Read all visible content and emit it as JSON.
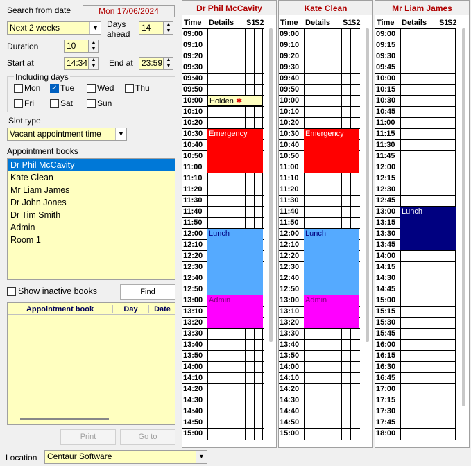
{
  "search": {
    "from_date_label": "Search from date",
    "from_date_value": "Mon 17/06/2024",
    "period_value": "Next 2 weeks",
    "days_ahead_label": "Days ahead",
    "days_ahead_value": "14",
    "duration_label": "Duration",
    "duration_value": "10",
    "start_label": "Start at",
    "start_value": "14:34",
    "end_label": "End at",
    "end_value": "23:59",
    "including_days_label": "Including days",
    "days": [
      {
        "label": "Mon",
        "checked": false
      },
      {
        "label": "Tue",
        "checked": true
      },
      {
        "label": "Wed",
        "checked": false
      },
      {
        "label": "Thu",
        "checked": false
      },
      {
        "label": "Fri",
        "checked": false
      },
      {
        "label": "Sat",
        "checked": false
      },
      {
        "label": "Sun",
        "checked": false
      }
    ],
    "slot_type_label": "Slot type",
    "slot_type_value": "Vacant appointment time",
    "books_label": "Appointment books",
    "books": [
      "Dr Phil McCavity",
      "Kate Clean",
      "Mr Liam James",
      "Dr John Jones",
      "Dr Tim Smith",
      "Admin",
      "Room 1"
    ],
    "show_inactive_label": "Show inactive books",
    "find_label": "Find",
    "results_headers": [
      "Appointment book",
      "Day",
      "Date"
    ],
    "print_label": "Print",
    "goto_label": "Go to",
    "location_label": "Location",
    "location_value": "Centaur Software"
  },
  "diary": {
    "headers": [
      "Time",
      "Details",
      "S1",
      "S2"
    ],
    "columns": [
      {
        "name": "Dr Phil McCavity",
        "times": [
          "09:00",
          "09:10",
          "09:20",
          "09:30",
          "09:40",
          "09:50",
          "10:00",
          "10:10",
          "10:20",
          "10:30",
          "10:40",
          "10:50",
          "11:00",
          "11:10",
          "11:20",
          "11:30",
          "11:40",
          "11:50",
          "12:00",
          "12:10",
          "12:20",
          "12:30",
          "12:40",
          "12:50",
          "13:00",
          "13:10",
          "13:20",
          "13:30",
          "13:40",
          "13:50",
          "14:00",
          "14:10",
          "14:20",
          "14:30",
          "14:40",
          "14:50",
          "15:00"
        ],
        "appointments": [
          {
            "label": "Holden",
            "start": 6,
            "length": 1,
            "color": "#ffffc0",
            "text": "#000000",
            "icon": true
          },
          {
            "label": "Emergency",
            "start": 9,
            "length": 4,
            "color": "#ff0000",
            "text": "#ffffff"
          },
          {
            "label": "Lunch",
            "start": 18,
            "length": 6,
            "color": "#55aaff",
            "text": "#000080"
          },
          {
            "label": "Admin",
            "start": 24,
            "length": 3,
            "color": "#ff00ff",
            "text": "#800080"
          }
        ]
      },
      {
        "name": "Kate Clean",
        "times": [
          "09:00",
          "09:10",
          "09:20",
          "09:30",
          "09:40",
          "09:50",
          "10:00",
          "10:10",
          "10:20",
          "10:30",
          "10:40",
          "10:50",
          "11:00",
          "11:10",
          "11:20",
          "11:30",
          "11:40",
          "11:50",
          "12:00",
          "12:10",
          "12:20",
          "12:30",
          "12:40",
          "12:50",
          "13:00",
          "13:10",
          "13:20",
          "13:30",
          "13:40",
          "13:50",
          "14:00",
          "14:10",
          "14:20",
          "14:30",
          "14:40",
          "14:50",
          "15:00"
        ],
        "appointments": [
          {
            "label": "Emergency",
            "start": 9,
            "length": 4,
            "color": "#ff0000",
            "text": "#ffffff"
          },
          {
            "label": "Lunch",
            "start": 18,
            "length": 6,
            "color": "#55aaff",
            "text": "#000080"
          },
          {
            "label": "Admin",
            "start": 24,
            "length": 3,
            "color": "#ff00ff",
            "text": "#800080"
          }
        ]
      },
      {
        "name": "Mr Liam James",
        "times": [
          "09:00",
          "09:15",
          "09:30",
          "09:45",
          "10:00",
          "10:15",
          "10:30",
          "10:45",
          "11:00",
          "11:15",
          "11:30",
          "11:45",
          "12:00",
          "12:15",
          "12:30",
          "12:45",
          "13:00",
          "13:15",
          "13:30",
          "13:45",
          "14:00",
          "14:15",
          "14:30",
          "14:45",
          "15:00",
          "15:15",
          "15:30",
          "15:45",
          "16:00",
          "16:15",
          "16:30",
          "16:45",
          "17:00",
          "17:15",
          "17:30",
          "17:45",
          "18:00"
        ],
        "appointments": [
          {
            "label": "Lunch",
            "start": 16,
            "length": 4,
            "color": "#000080",
            "text": "#ffffff"
          }
        ]
      }
    ]
  }
}
